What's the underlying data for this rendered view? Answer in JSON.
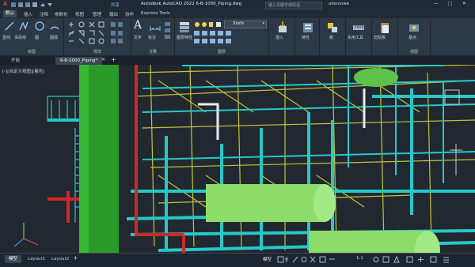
{
  "titlebar": {
    "app_icon": "A",
    "share_label": "共享",
    "title": "Autodesk AutoCAD 2022    6-B-1000_Piping.dwg",
    "search_placeholder": "键入关键字或短语",
    "user": "allenlowe"
  },
  "menu": {
    "tabs": [
      "默认",
      "插入",
      "注释",
      "参数化",
      "视图",
      "管理",
      "输出",
      "协作",
      "Express Tools"
    ],
    "active": 0
  },
  "ribbon": {
    "draw": {
      "label": "绘图",
      "buttons": [
        "直线",
        "多段线",
        "圆",
        "圆弧"
      ]
    },
    "modify": {
      "label": "修改"
    },
    "annotation": {
      "label": "注释",
      "buttons": [
        "文字",
        "标注"
      ]
    },
    "block": {
      "label": "插入",
      "button": "插入"
    },
    "layers": {
      "label": "图层",
      "layer_props": "图层特性",
      "current_layer": "Xrefs"
    },
    "properties": {
      "button": "特性",
      "label": ""
    },
    "groups": {
      "button": "组"
    },
    "utilities": {
      "button": "实用工具"
    },
    "clipboard": {
      "button": "剪贴板"
    },
    "view": {
      "button": "基点",
      "label": "视图"
    }
  },
  "filetabs": {
    "start": "开始",
    "active_file": "6-B-1000_Piping*"
  },
  "viewport": {
    "label": "[-][自定义视图][着色]"
  },
  "status": {
    "tabs": [
      "模型",
      "Layout1",
      "Layout2"
    ],
    "active": 0,
    "model_label": "模型",
    "scale": "1:1"
  },
  "colors": {
    "accent": "#cc2a2a",
    "ribbon_bg": "#2c3846",
    "viewport_bg": "#212830"
  }
}
